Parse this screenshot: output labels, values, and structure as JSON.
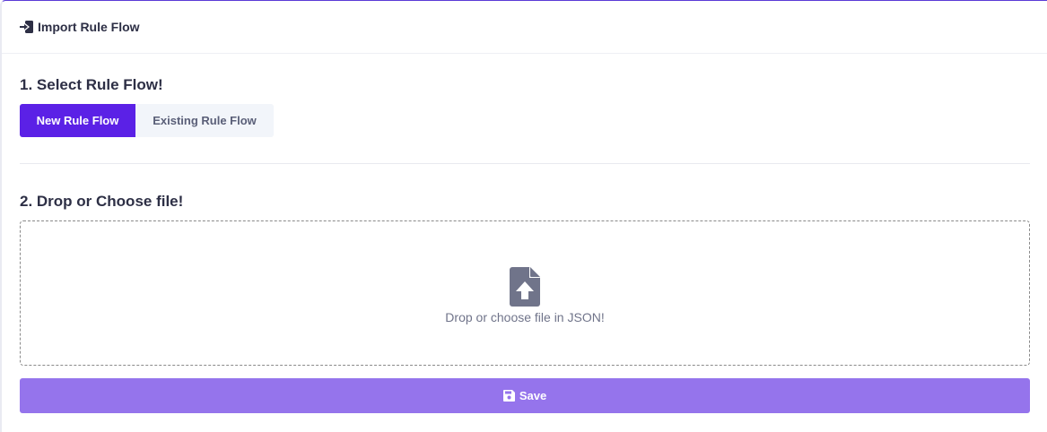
{
  "header": {
    "title": "Import Rule Flow",
    "icon": "import-icon"
  },
  "section1": {
    "title": "1. Select Rule Flow!"
  },
  "toggle": {
    "options": [
      "New Rule Flow",
      "Existing Rule Flow"
    ],
    "selected": "New Rule Flow"
  },
  "section2": {
    "title": "2. Drop or Choose file!"
  },
  "dropzone": {
    "text": "Drop or choose file in JSON!",
    "icon": "file-upload-icon"
  },
  "save": {
    "label": "Save",
    "icon": "floppy-disk-icon"
  },
  "colors": {
    "accent": "#5b21e6",
    "save_button": "#9574ec",
    "inactive_button": "#f2f5fa",
    "text": "#2d2f45"
  }
}
